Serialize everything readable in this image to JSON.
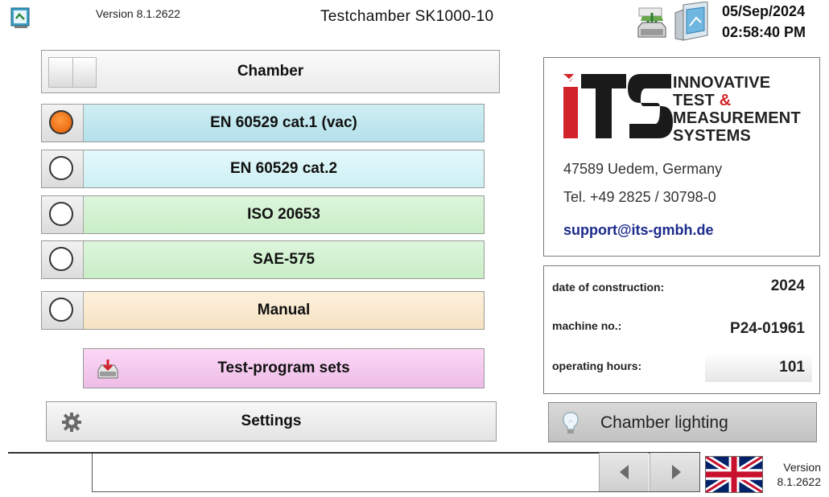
{
  "header": {
    "version": "Version 8.1.2622",
    "title": "Testchamber  SK1000-10",
    "date": "05/Sep/2024",
    "time": "02:58:40 PM"
  },
  "chamber": {
    "label": "Chamber"
  },
  "programs": [
    {
      "label": "EN 60529 cat.1 (vac)",
      "selected": true
    },
    {
      "label": "EN 60529 cat.2",
      "selected": false
    },
    {
      "label": "ISO 20653",
      "selected": false
    },
    {
      "label": "SAE-575",
      "selected": false
    },
    {
      "label": "Manual",
      "selected": false
    }
  ],
  "test_program_sets": {
    "label": "Test-program sets"
  },
  "settings": {
    "label": "Settings"
  },
  "company": {
    "logo_text": "iTS",
    "name_line1": "INNOVATIVE",
    "name_line2": "TEST",
    "name_amp": "&",
    "name_line3": "MEASUREMENT",
    "name_line4": "SYSTEMS",
    "address": "47589 Uedem, Germany",
    "tel": "Tel. +49 2825 / 30798-0",
    "email": "support@its-gmbh.de"
  },
  "info": {
    "construction_label": "date of construction:",
    "construction_value": "2024",
    "machine_label": "machine no.:",
    "machine_value": "P24-01961",
    "hours_label": "operating hours:",
    "hours_value": "101"
  },
  "lighting": {
    "label": "Chamber lighting"
  },
  "footer": {
    "status_text": "",
    "version_line1": "Version",
    "version_line2": "8.1.2622"
  },
  "colors": {
    "radio_selected": "#e25a00",
    "brand_red": "#d2232a",
    "email_blue": "#1c2b8c"
  }
}
